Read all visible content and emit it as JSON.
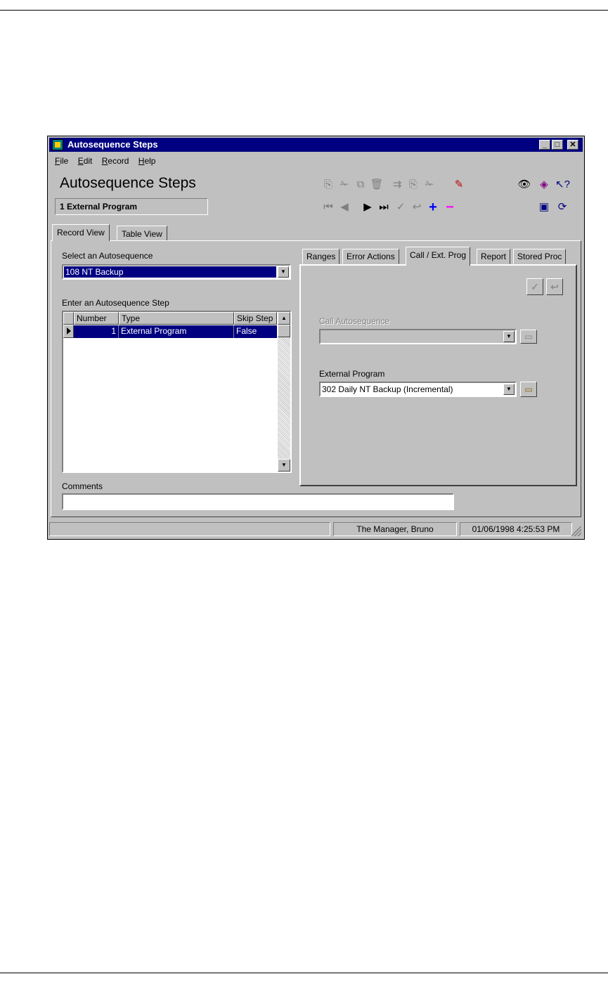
{
  "window": {
    "title": "Autosequence Steps",
    "menu": [
      {
        "label": "File",
        "accel": "F",
        "rest": "ile"
      },
      {
        "label": "Edit",
        "accel": "E",
        "rest": "dit"
      },
      {
        "label": "Record",
        "accel": "R",
        "rest": "ecord"
      },
      {
        "label": "Help",
        "accel": "H",
        "rest": "elp"
      }
    ]
  },
  "header": {
    "title": "Autosequence Steps",
    "current_record": "1  External Program"
  },
  "outer_tabs": [
    {
      "label": "Record View",
      "active": true
    },
    {
      "label": "Table View",
      "active": false
    }
  ],
  "left": {
    "select_label": "Select an Autosequence",
    "select_value": "108  NT Backup",
    "step_label": "Enter an Autosequence Step",
    "grid": {
      "columns": [
        "Number",
        "Type",
        "Skip Step"
      ],
      "rows": [
        {
          "number": "1",
          "type": "External Program",
          "skip": "False"
        }
      ]
    },
    "comments_label": "Comments",
    "comments_value": ""
  },
  "inner_tabs": [
    {
      "label": "Ranges",
      "active": false
    },
    {
      "label": "Error Actions",
      "active": false
    },
    {
      "label": "Call / Ext. Prog",
      "active": true
    },
    {
      "label": "Report",
      "active": false
    },
    {
      "label": "Stored Proc",
      "active": false
    }
  ],
  "call_ext": {
    "call_label": "Call Autosequence",
    "call_value": "",
    "ext_label": "External Program",
    "ext_value": "302  Daily NT Backup (Incremental)"
  },
  "status": {
    "left": "",
    "user": "The Manager, Bruno",
    "datetime": "01/06/1998 4:25:53 PM"
  },
  "icons": [
    "app-icon",
    "minimize-icon",
    "maximize-icon",
    "close-icon",
    "copy-record-icon",
    "cut-record-icon",
    "paste-record-icon",
    "delete-record-icon",
    "first-record-icon",
    "prev-record-icon",
    "next-record-icon",
    "last-record-icon",
    "save-check-icon",
    "undo-icon",
    "add-record-icon",
    "remove-record-icon",
    "find-binoculars-icon",
    "book-icon",
    "help-pointer-icon",
    "browse-folder-icon"
  ]
}
